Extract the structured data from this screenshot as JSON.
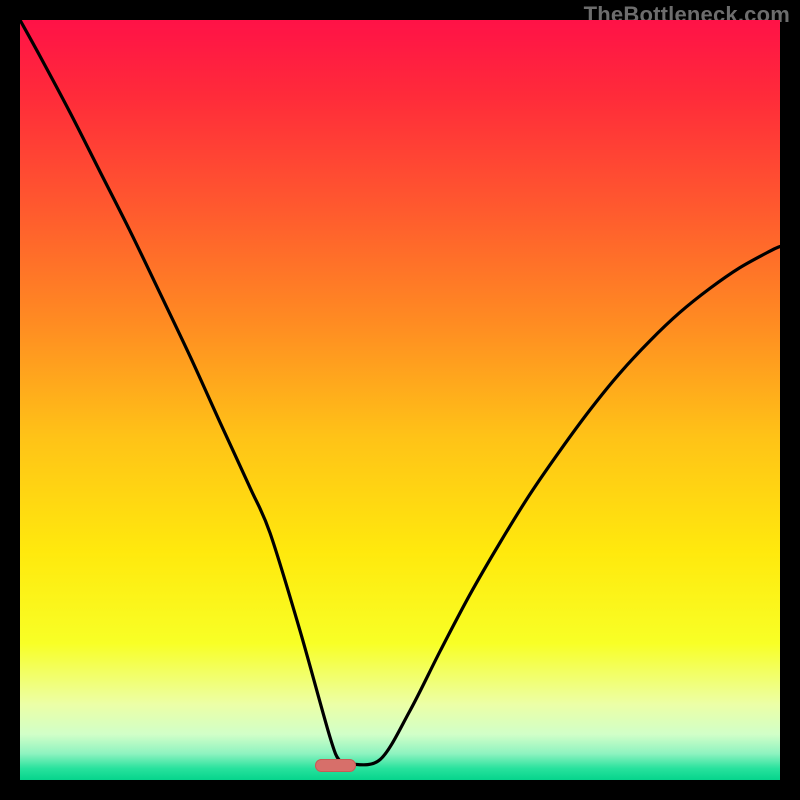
{
  "watermark": "TheBottleneck.com",
  "colors": {
    "black": "#000000",
    "gradient_stops": [
      {
        "offset": 0.0,
        "color": "#ff1247"
      },
      {
        "offset": 0.1,
        "color": "#ff2b3a"
      },
      {
        "offset": 0.25,
        "color": "#ff5a2e"
      },
      {
        "offset": 0.4,
        "color": "#ff8c22"
      },
      {
        "offset": 0.55,
        "color": "#ffc317"
      },
      {
        "offset": 0.7,
        "color": "#ffe90d"
      },
      {
        "offset": 0.82,
        "color": "#f8ff26"
      },
      {
        "offset": 0.9,
        "color": "#ecffa6"
      },
      {
        "offset": 0.94,
        "color": "#d1ffc8"
      },
      {
        "offset": 0.965,
        "color": "#8ff3c0"
      },
      {
        "offset": 0.985,
        "color": "#27e29d"
      },
      {
        "offset": 1.0,
        "color": "#06d48c"
      }
    ],
    "curve": "#000000",
    "pill_fill": "#d76f6a",
    "pill_stroke": "#c85b55",
    "watermark": "#6d6d6d"
  },
  "pill": {
    "x_frac": 0.415,
    "y_frac": 0.981,
    "w_frac": 0.055,
    "h_frac": 0.018
  },
  "chart_data": {
    "type": "line",
    "title": "",
    "xlabel": "",
    "ylabel": "",
    "xlim": [
      0,
      100
    ],
    "ylim": [
      0,
      100
    ],
    "note": "No axes or tick labels are rendered; values are estimated from the curve geometry on a 0–100 grid. y=0 at the bottom (green) and y=100 at the top (red). The curve is a V-shape with its minimum near x≈44, y≈2, and a small flat segment at the bottom matching the pill marker.",
    "series": [
      {
        "name": "curve",
        "x": [
          0.0,
          2.6,
          6.6,
          10.5,
          14.5,
          18.4,
          22.4,
          26.3,
          30.3,
          32.9,
          36.8,
          40.8,
          42.1,
          43.4,
          47.4,
          51.3,
          55.3,
          59.2,
          63.2,
          67.1,
          71.1,
          75.0,
          78.9,
          82.9,
          86.8,
          90.8,
          94.7,
          98.7,
          100.0
        ],
        "y": [
          100.0,
          95.3,
          87.8,
          80.1,
          72.2,
          64.1,
          55.7,
          47.1,
          38.4,
          32.5,
          19.8,
          5.6,
          2.5,
          2.1,
          2.7,
          9.1,
          17.0,
          24.4,
          31.3,
          37.6,
          43.4,
          48.7,
          53.5,
          57.8,
          61.5,
          64.7,
          67.4,
          69.6,
          70.2
        ]
      }
    ],
    "marker": {
      "shape": "pill",
      "x_center": 44.3,
      "y_center": 1.9,
      "width": 5.5,
      "height": 1.8
    },
    "background": "vertical_gradient_red_to_green"
  }
}
